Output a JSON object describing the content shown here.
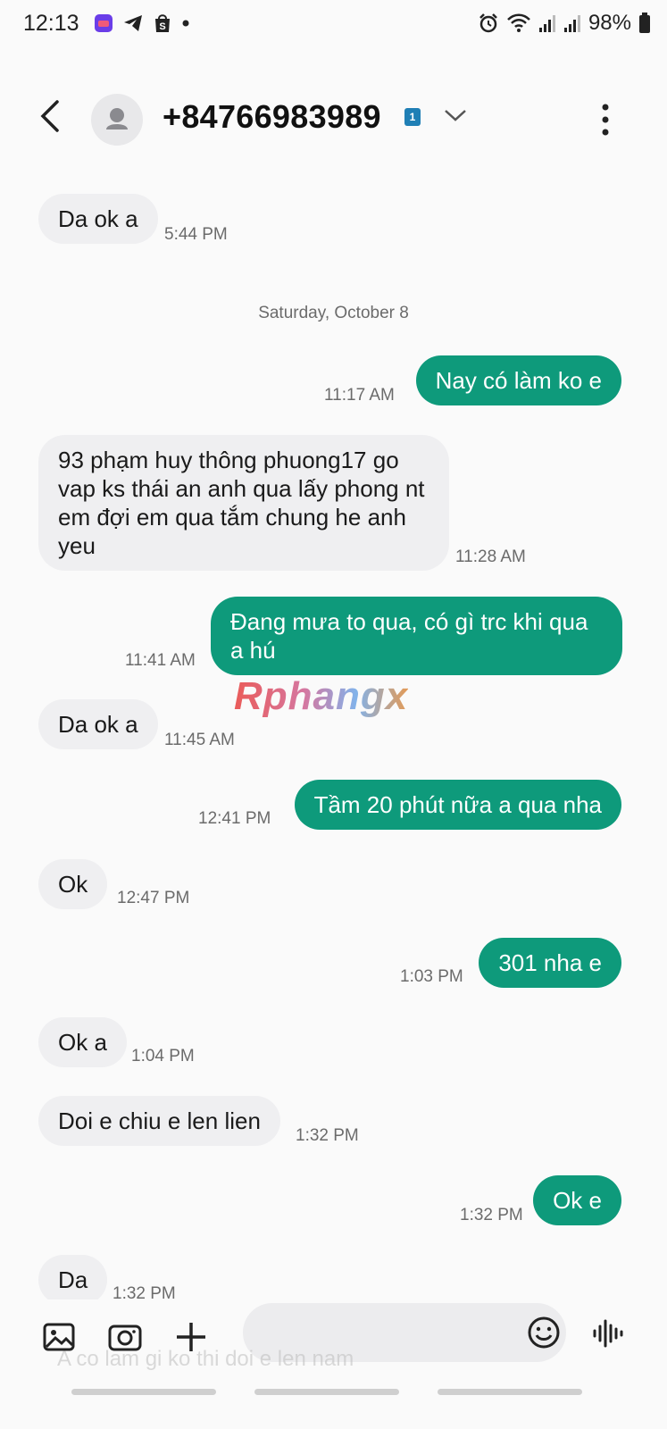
{
  "status_bar": {
    "time": "12:13",
    "battery": "98%",
    "app_icons": [
      "lazada-icon",
      "telegram-icon",
      "shopee-icon",
      "dot-icon"
    ],
    "right_icons": [
      "alarm-icon",
      "wifi-icon",
      "signal-icon",
      "signal-icon",
      "battery-icon"
    ]
  },
  "header": {
    "title": "+84766983989",
    "sim_badge": "1"
  },
  "thread": {
    "date_separator": "Saturday, October 8",
    "messages": [
      {
        "dir": "in",
        "text": "Da ok a",
        "time": "5:44 PM"
      },
      {
        "dir": "out",
        "text": "Nay có làm ko e",
        "time": "11:17 AM"
      },
      {
        "dir": "in",
        "text": "93 phạm huy thông phuong17 go vap ks thái an anh qua lấy phong nt em đợi em qua tắm chung he anh yeu",
        "time": "11:28 AM"
      },
      {
        "dir": "out",
        "text": "Đang mưa to qua, có gì trc khi qua a hú",
        "time": "11:41 AM"
      },
      {
        "dir": "in",
        "text": "Da ok a",
        "time": "11:45 AM"
      },
      {
        "dir": "out",
        "text": "Tầm 20 phút nữa a qua nha",
        "time": "12:41 PM"
      },
      {
        "dir": "in",
        "text": "Ok",
        "time": "12:47 PM"
      },
      {
        "dir": "out",
        "text": "301 nha e",
        "time": "1:03 PM"
      },
      {
        "dir": "in",
        "text": "Ok a",
        "time": "1:04 PM"
      },
      {
        "dir": "in",
        "text": "Doi e chiu e len lien",
        "time": "1:32 PM"
      },
      {
        "dir": "out",
        "text": "Ok e",
        "time": "1:32 PM"
      },
      {
        "dir": "in",
        "text": "Da",
        "time": "1:32 PM"
      }
    ]
  },
  "watermark": "Rphangx",
  "composer": {
    "placeholder": "",
    "behind_text": "A co lam gi ko thi doi e len nam"
  },
  "colors": {
    "outgoing": "#0e9a7b",
    "incoming": "#efeff1",
    "background": "#fafafa"
  }
}
